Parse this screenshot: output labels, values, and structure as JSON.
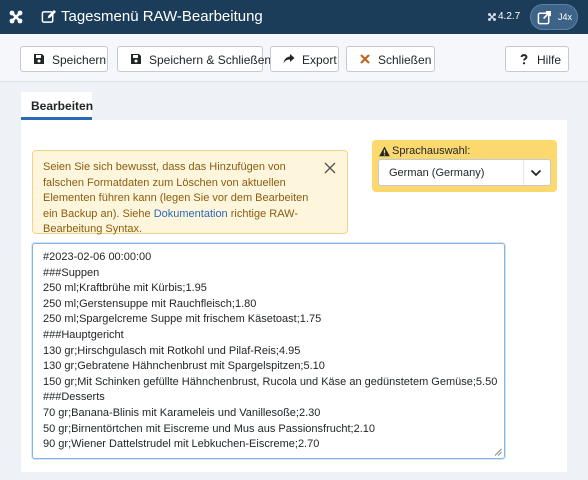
{
  "header": {
    "title": "Tagesmenü RAW-Bearbeitung",
    "version": "4.2.7",
    "pill_label": "J4x"
  },
  "toolbar": {
    "save": "Speichern",
    "save_close": "Speichern & Schließen",
    "export": "Export",
    "close": "Schließen",
    "help": "Hilfe"
  },
  "tabs": [
    {
      "label": "Bearbeiten"
    }
  ],
  "alert": {
    "text_before": "Seien Sie sich bewusst, dass das Hinzufügen von falschen Formatdaten zum Löschen von aktuellen Elementen führen kann (legen Sie vor dem Bearbeiten ein Backup an). Siehe ",
    "link": "Dokumentation",
    "text_after": " richtige RAW-Bearbeitung Syntax."
  },
  "language": {
    "label": "Sprachauswahl:",
    "selected": "German (Germany)"
  },
  "editor": {
    "lines": [
      "#2023-02-06 00:00:00",
      "###Suppen",
      "250 ml;Kraftbrühe mit Kürbis;1.95",
      "250 ml;Gerstensuppe mit Rauchfleisch;1.80",
      "250 ml;Spargelcreme Suppe mit frischem Käsetoast;1.75",
      "###Hauptgericht",
      "130 gr;Hirschgulasch mit Rotkohl und Pilaf-Reis;4.95",
      "130 gr;Gebratene Hähnchenbrust mit Spargelspitzen;5.10",
      "150 gr;Mit Schinken gefüllte Hähnchenbrust, Rucola und Käse an gedünstetem Gemüse;5.50",
      "###Desserts",
      "70 gr;Banana-Blinis mit Karameleis und Vanillesoße;2.30",
      "50 gr;Birnentörtchen mit Eiscreme und Mus aus Passionsfrucht;2.10",
      "90 gr;Wiener Dattelstrudel mit Lebkuchen-Eiscreme;2.70"
    ]
  },
  "colors": {
    "header_bg": "#1c3d5a",
    "accent": "#2a69b8",
    "alert_bg": "#fdf5dc",
    "alert_text": "#8a5d10",
    "language_bg": "#fbd96e",
    "close_icon": "#c0641b"
  },
  "icons": {
    "logo": "joomla-logo-icon",
    "title": "edit-icon",
    "version": "joomla-small-icon",
    "pill": "external-link-icon",
    "save": "save-icon",
    "save_close": "save-icon",
    "export": "share-arrow-icon",
    "close": "x-icon",
    "help": "question-icon",
    "alert_close": "close-icon",
    "language_warning": "warning-icon",
    "select": "chevron-down-icon"
  }
}
